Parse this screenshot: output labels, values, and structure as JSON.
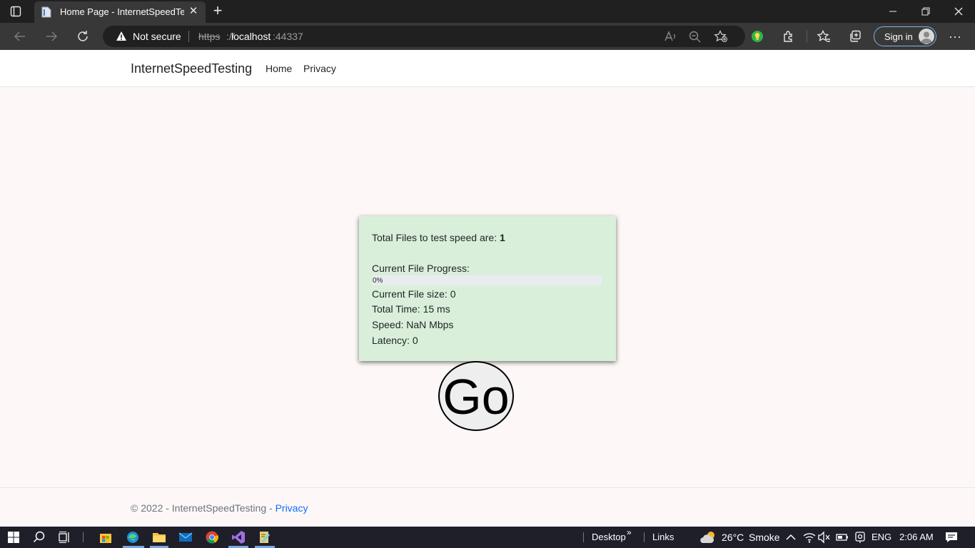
{
  "browser": {
    "tab_title": "Home Page - InternetSpeedTesting",
    "security_label": "Not secure",
    "url_scheme": "https",
    "url_slashes": "://",
    "url_host": "localhost",
    "url_port": ":44337",
    "signin_label": "Sign in",
    "more_label": "···"
  },
  "site": {
    "brand": "InternetSpeedTesting",
    "nav": [
      "Home",
      "Privacy"
    ]
  },
  "speed_test": {
    "total_files_label": "Total Files to test speed are: ",
    "total_files": "1",
    "progress_label": "Current File Progress:",
    "progress_text": "0%",
    "progress_value": 0,
    "file_size": "Current File size: 0",
    "total_time": "Total Time: 15 ms",
    "speed": "Speed: NaN Mbps",
    "latency": "Latency: 0",
    "go_label": "Go"
  },
  "footer": {
    "text": "© 2022 - InternetSpeedTesting - ",
    "link": "Privacy"
  },
  "taskbar": {
    "desktop": "Desktop",
    "chevron": "»",
    "links": "Links",
    "temperature": "26°C",
    "weather": "Smoke",
    "language": "ENG",
    "time": "2:06 AM"
  },
  "colors": {
    "card_bg": "#d9efd9",
    "page_bg": "#fdf8f7",
    "link": "#0d6efd",
    "browser_dark": "#202020"
  },
  "icons": [
    "tab-actions-icon",
    "document-icon",
    "close-icon",
    "plus-icon",
    "minimize-icon",
    "restore-icon",
    "back-icon",
    "forward-icon",
    "refresh-icon",
    "warning-icon",
    "read-aloud-icon",
    "zoom-out-icon",
    "add-favorite-icon",
    "extension-bulb-icon",
    "extensions-icon",
    "favorites-icon",
    "collections-icon",
    "more-icon",
    "windows-icon",
    "search-icon",
    "task-view-icon",
    "store-icon",
    "edge-icon",
    "file-explorer-icon",
    "mail-icon",
    "chrome-icon",
    "visual-studio-icon",
    "notepad-icon",
    "weather-icon",
    "chevron-up-icon",
    "wifi-icon",
    "mute-icon",
    "battery-icon",
    "location-icon",
    "notification-icon"
  ]
}
